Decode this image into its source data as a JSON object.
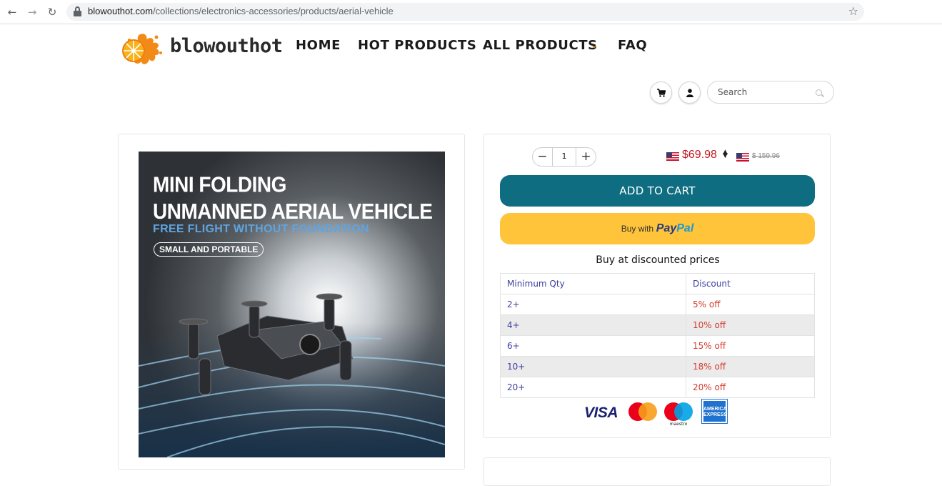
{
  "browser": {
    "url_host": "blowouthot.com",
    "url_path": "/collections/electronics-accessories/products/aerial-vehicle"
  },
  "header": {
    "logo_text": "blowouthot",
    "nav": [
      "HOME",
      "HOT PRODUCTS",
      "ALL PRODUCTS",
      "FAQ"
    ],
    "search_placeholder": "Search"
  },
  "product_image": {
    "headline_line1": "MINI FOLDING",
    "headline_line2": "UNMANNED AERIAL VEHICLE",
    "subtitle": "FREE FLIGHT WITHOUT FOUNDATION",
    "badge": "SMALL AND PORTABLE"
  },
  "purchase": {
    "quantity": "1",
    "price": "$69.98",
    "old_price": "$ 159.96",
    "add_to_cart": "ADD TO CART",
    "paypal_prefix": "Buy with",
    "paypal_brand_1": "Pay",
    "paypal_brand_2": "Pal",
    "discount_title": "Buy at discounted prices",
    "discount_headers": [
      "Minimum Qty",
      "Discount"
    ],
    "discount_rows": [
      {
        "qty": "2+",
        "discount": "5% off"
      },
      {
        "qty": "4+",
        "discount": "10% off"
      },
      {
        "qty": "6+",
        "discount": "15% off"
      },
      {
        "qty": "10+",
        "discount": "18% off"
      },
      {
        "qty": "20+",
        "discount": "20% off"
      }
    ],
    "payment_logos": {
      "visa": "VISA",
      "maestro": "maestro",
      "amex": "AMERICAN EXPRESS"
    }
  },
  "colors": {
    "add_to_cart_bg": "#0e6d80",
    "paypal_bg": "#ffc43a",
    "price_red": "#c3181f",
    "qty_blue": "#3b3f9e",
    "discount_red": "#d63a2c",
    "nav_chevron": "#e0a33a"
  },
  "icons": [
    "back-arrow-icon",
    "forward-arrow-icon",
    "reload-icon",
    "lock-icon",
    "bookmark-star-icon",
    "chevron-down-icon",
    "cart-icon",
    "user-icon",
    "search-icon",
    "flag-us-icon",
    "sort-caret-icon"
  ]
}
